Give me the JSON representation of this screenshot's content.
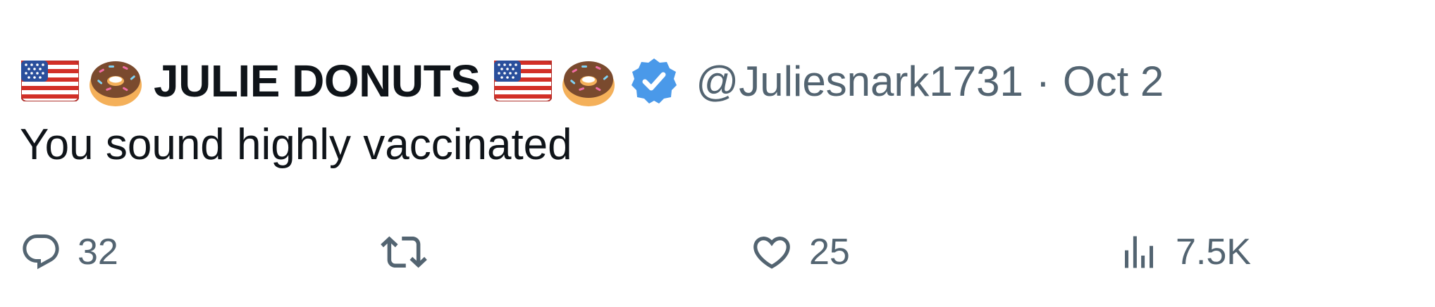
{
  "author": {
    "display_name": "JULIE DONUTS",
    "emoji_prefix": [
      "us-flag-icon",
      "donut-icon"
    ],
    "emoji_suffix": [
      "us-flag-icon",
      "donut-icon"
    ],
    "verified": true,
    "verified_color": "#4a99e9",
    "handle": "@Juliesnark1731",
    "separator": "·",
    "date": "Oct 2"
  },
  "tweet": {
    "text": "You sound highly vaccinated"
  },
  "actions": {
    "replies": "32",
    "retweets": "",
    "likes": "25",
    "views": "7.5K",
    "icon_color": "#536471"
  }
}
